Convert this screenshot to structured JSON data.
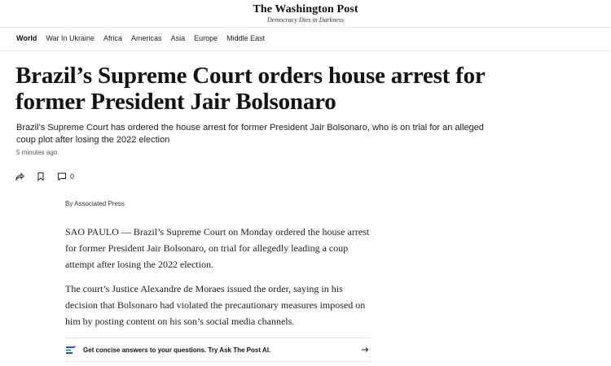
{
  "masthead": {
    "logo": "The Washington Post",
    "tagline": "Democracy Dies in Darkness"
  },
  "nav": {
    "items": [
      {
        "label": "World",
        "active": true
      },
      {
        "label": "War In Ukraine",
        "active": false
      },
      {
        "label": "Africa",
        "active": false
      },
      {
        "label": "Americas",
        "active": false
      },
      {
        "label": "Asia",
        "active": false
      },
      {
        "label": "Europe",
        "active": false
      },
      {
        "label": "Middle East",
        "active": false
      }
    ]
  },
  "article": {
    "headline": "Brazil’s Supreme Court orders house arrest for former President Jair Bolsonaro",
    "dek": "Brazil’s Supreme Court has ordered the house arrest for former President Jair Bolsonaro, who is on trial for an alleged coup plot after losing the 2022 election",
    "timestamp": "5 minutes ago",
    "comment_count": "0",
    "byline": "By Associated Press",
    "paragraphs": [
      "SAO PAULO — Brazil’s Supreme Court on Monday ordered the house arrest for former President Jair Bolsonaro, on trial for allegedly leading a coup attempt after losing the 2022 election.",
      "The court’s Justice Alexandre de Moraes issued the order, saying in his decision that Bolsonaro had violated the precautionary measures imposed on him by posting content on his son’s social media channels."
    ]
  },
  "ask": {
    "label": "Get concise answers to your questions. Try Ask The Post AI."
  },
  "icons": {
    "share": "share-icon",
    "bookmark": "bookmark-icon",
    "comment": "comment-icon",
    "ask": "ask-ai-icon",
    "arrow": "arrow-right-icon"
  },
  "colors": {
    "text": "#111111",
    "rule": "#e4e4e4",
    "accent_blue": "#1a5fb4",
    "accent_teal": "#2aa198"
  }
}
